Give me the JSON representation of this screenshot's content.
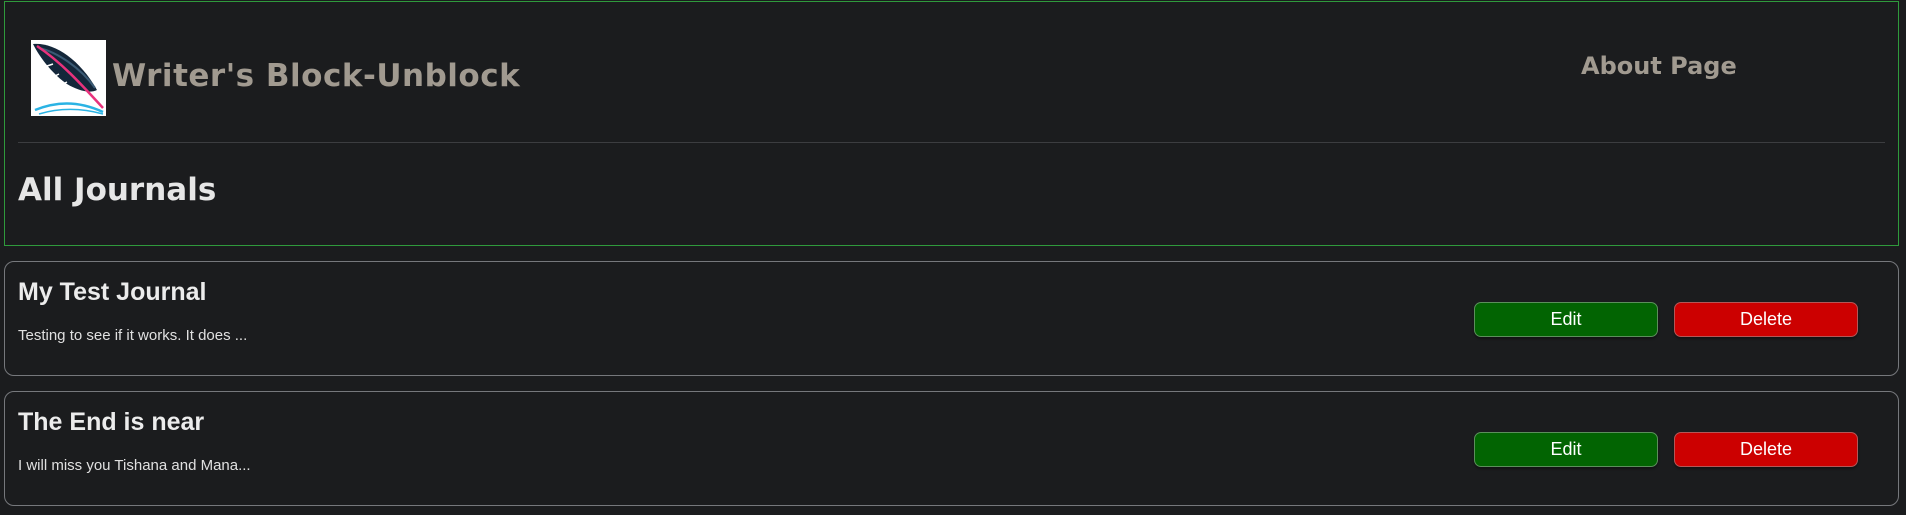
{
  "header": {
    "site_title": "Writer's Block-Unblock",
    "about_link": "About Page",
    "page_title": "All Journals",
    "logo_icon": "feather-quill-icon"
  },
  "journals": [
    {
      "title": "My Test Journal",
      "excerpt": "Testing to see if it works. It does ...",
      "edit_label": "Edit",
      "delete_label": "Delete"
    },
    {
      "title": "The End is near",
      "excerpt": "I will miss you Tishana and Mana...",
      "edit_label": "Edit",
      "delete_label": "Delete"
    }
  ],
  "colors": {
    "background": "#1b1c1e",
    "header_border": "#2f9a3c",
    "edit_button": "#026402",
    "delete_button": "#cc0000",
    "muted_text": "#a19a90"
  }
}
